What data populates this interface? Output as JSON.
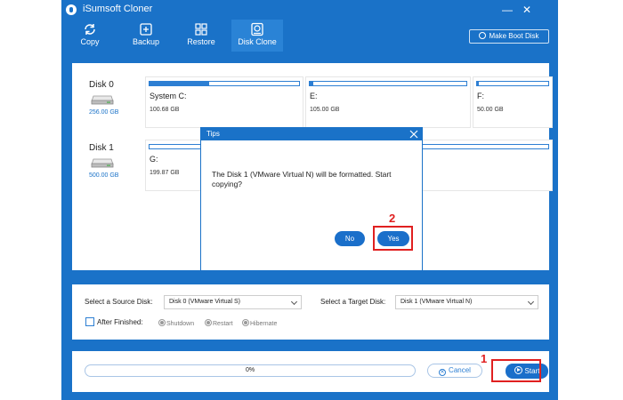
{
  "window": {
    "title": "iSumsoft Cloner",
    "controls": {
      "minimize": "—",
      "close": "✕"
    }
  },
  "nav": {
    "items": [
      {
        "label": "Copy",
        "icon": "refresh-icon"
      },
      {
        "label": "Backup",
        "icon": "backup-icon"
      },
      {
        "label": "Restore",
        "icon": "restore-icon"
      },
      {
        "label": "Disk Clone",
        "icon": "disk-clone-icon",
        "active": true
      }
    ],
    "make_boot_disk": "Make Boot Disk"
  },
  "disks": [
    {
      "name": "Disk 0",
      "size": "256.00 GB",
      "partitions": [
        {
          "name": "System C:",
          "size": "100.68 GB",
          "used_fraction": 0.4
        },
        {
          "name": "E:",
          "size": "105.00 GB",
          "used_fraction": 0.02
        },
        {
          "name": "F:",
          "size": "50.00 GB",
          "used_fraction": 0.02
        }
      ]
    },
    {
      "name": "Disk 1",
      "size": "500.00 GB",
      "partitions": [
        {
          "name": "G:",
          "size": "199.87 GB",
          "used_fraction": 0
        },
        {
          "name": "",
          "size": "",
          "used_fraction": 0
        }
      ]
    }
  ],
  "selection": {
    "source_label": "Select a Source Disk:",
    "source_value": "Disk 0 (VMware Virtual S)",
    "target_label": "Select a Target Disk:",
    "target_value": "Disk 1 (VMware Virtual N)",
    "after_finished_label": "After Finished:",
    "options": [
      "Shutdown",
      "Restart",
      "Hibernate"
    ]
  },
  "progress": {
    "percent_text": "0%",
    "value": 0,
    "cancel_label": "Cancel",
    "start_label": "Start"
  },
  "dialog": {
    "title": "Tips",
    "message": "The Disk 1 (VMware Virtual N) will be formatted. Start copying?",
    "no_label": "No",
    "yes_label": "Yes"
  },
  "annotations": {
    "step1": "1",
    "step2": "2"
  },
  "colors": {
    "app_blue": "#1a72c8",
    "button_blue": "#1a6fca",
    "annotation_red": "#e02020"
  }
}
